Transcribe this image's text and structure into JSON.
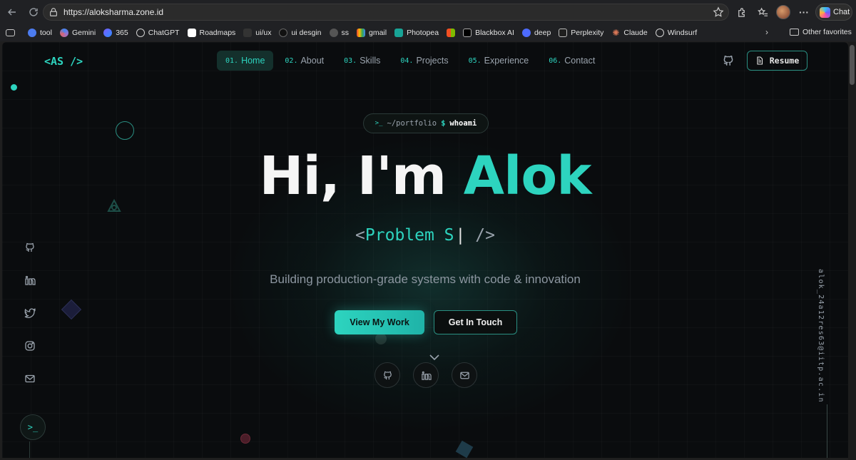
{
  "browser": {
    "url": "https://aloksharma.zone.id",
    "chat_label": "Chat",
    "bookmarks": [
      "tool",
      "Gemini",
      "365",
      "ChatGPT",
      "Roadmaps",
      "ui/ux",
      "ui desgin",
      "ss",
      "gmail",
      "Photopea",
      "",
      "Blackbox AI",
      "deep",
      "Perplexity",
      "Claude",
      "Windsurf"
    ],
    "other_favorites": "Other favorites"
  },
  "site": {
    "logo": "<AS />",
    "nav": [
      {
        "num": "01.",
        "label": "Home",
        "active": true
      },
      {
        "num": "02.",
        "label": "About"
      },
      {
        "num": "03.",
        "label": "Skills"
      },
      {
        "num": "04.",
        "label": "Projects"
      },
      {
        "num": "05.",
        "label": "Experience"
      },
      {
        "num": "06.",
        "label": "Contact"
      }
    ],
    "resume_label": "Resume",
    "accent": "#2dd4bf"
  },
  "hero": {
    "cmd_prompt": ">_",
    "cmd_path": "~/portfolio",
    "cmd_dollar": "$",
    "cmd_command": "whoami",
    "greeting": "Hi, I'm ",
    "name": "Alok",
    "typed_open": "<",
    "typed_text": "Problem S",
    "typed_caret": "|",
    "typed_close": " />",
    "subtitle": "Building production-grade systems with code & innovation",
    "primary_cta": "View My Work",
    "secondary_cta": "Get In Touch"
  },
  "side": {
    "terminal_glyph": ">_",
    "email_vertical": "alok_24a12res63@iitp.ac.in"
  }
}
